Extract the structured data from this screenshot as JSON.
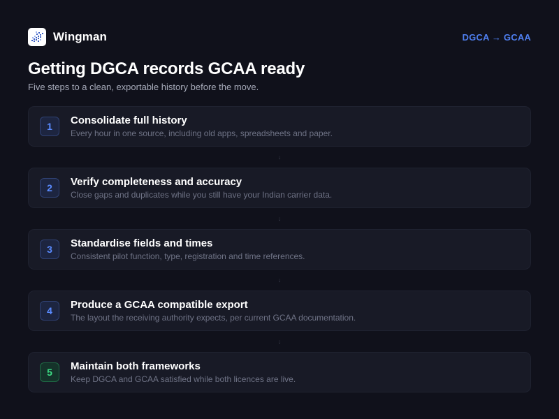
{
  "app": {
    "name": "Wingman",
    "logo_icon": "wingman-logo-icon",
    "route": "DGCA → GCAA"
  },
  "page": {
    "title": "Getting DGCA records GCAA ready",
    "subtitle": "Five steps to a clean, exportable history before the move."
  },
  "connector_glyph": "↓",
  "steps": [
    {
      "number": "1",
      "title": "Consolidate full history",
      "description": "Every hour in one source, including old apps, spreadsheets and paper.",
      "status": "pending"
    },
    {
      "number": "2",
      "title": "Verify completeness and accuracy",
      "description": "Close gaps and duplicates while you still have your Indian carrier data.",
      "status": "pending"
    },
    {
      "number": "3",
      "title": "Standardise fields and times",
      "description": "Consistent pilot function, type, registration and time references.",
      "status": "pending"
    },
    {
      "number": "4",
      "title": "Produce a GCAA compatible export",
      "description": "The layout the receiving authority expects, per current GCAA documentation.",
      "status": "pending"
    },
    {
      "number": "5",
      "title": "Maintain both frameworks",
      "description": "Keep DGCA and GCAA satisfied while both licences are live.",
      "status": "done"
    }
  ],
  "colors": {
    "background": "#10111b",
    "card": "#181a26",
    "accent_blue": "#4f7ff0",
    "accent_green": "#3ddc84"
  }
}
